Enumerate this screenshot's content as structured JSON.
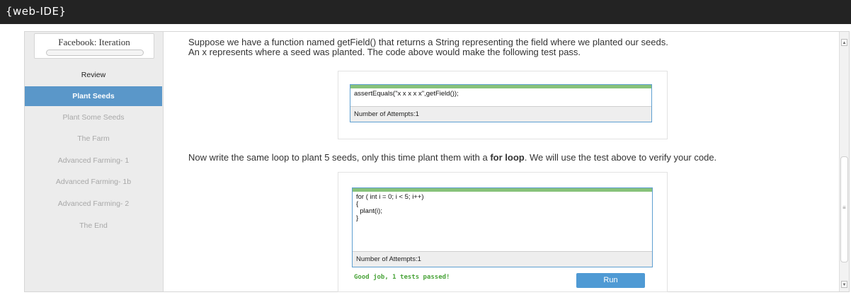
{
  "app": {
    "brand": "{web-IDE}"
  },
  "sidebar": {
    "course_title": "Facebook: Iteration",
    "items": [
      {
        "label": "Review",
        "state": "done"
      },
      {
        "label": "Plant Seeds",
        "state": "active"
      },
      {
        "label": "Plant Some Seeds",
        "state": "locked"
      },
      {
        "label": "The Farm",
        "state": "locked"
      },
      {
        "label": "Advanced Farming- 1",
        "state": "locked"
      },
      {
        "label": "Advanced Farming- 1b",
        "state": "locked"
      },
      {
        "label": "Advanced Farming- 2",
        "state": "locked"
      },
      {
        "label": "The End",
        "state": "locked"
      }
    ]
  },
  "lesson": {
    "intro_line1": "Suppose we have a function named getField() that returns a String representing the field where we planted our seeds.",
    "intro_line2": "An x represents where a seed was planted. The code above would make the following test pass.",
    "test_code": "assertEquals(\"x x x x x\",getField());",
    "test_attempts": "Number of Attempts:1",
    "instruction_before": "Now write the same loop to plant 5 seeds, only this time plant them with a ",
    "instruction_bold": "for loop",
    "instruction_after": ". We will use the test above to verify your code.",
    "editor_code": "for ( int i = 0; i < 5; i++)\n{\n  plant(i);\n}",
    "editor_attempts": "Number of Attempts:1",
    "result_message": "Good job, 1 tests passed!",
    "run_label": "Run"
  },
  "colors": {
    "topbar": "#232323",
    "active_nav": "#5a97c9",
    "editor_header": "#87c27a",
    "run_button": "#4f9ad4",
    "pass_text": "#4aa43a"
  },
  "icons": {
    "scroll_up": "triangle-up",
    "scroll_down": "triangle-down",
    "scroll_grip": "equals-grip"
  }
}
